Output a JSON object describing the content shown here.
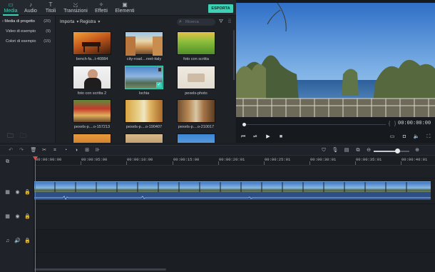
{
  "tabs": [
    {
      "label": "Media",
      "icon": "folder-icon",
      "active": true
    },
    {
      "label": "Audio",
      "icon": "music-note-icon"
    },
    {
      "label": "Titoli",
      "icon": "text-icon"
    },
    {
      "label": "Transizioni",
      "icon": "transition-icon"
    },
    {
      "label": "Effetti",
      "icon": "effects-icon"
    },
    {
      "label": "Elementi",
      "icon": "image-icon"
    }
  ],
  "export_label": "ESPORTA",
  "sidebar": {
    "items": [
      {
        "label": "Media di progetto",
        "count": "(20)",
        "expanded": true
      },
      {
        "label": "Video di esempio",
        "count": "(9)"
      },
      {
        "label": "Colori di esempio",
        "count": "(15)"
      }
    ]
  },
  "media_toolbar": {
    "import_label": "Importa",
    "record_label": "Registra",
    "search_placeholder": "Ricerca"
  },
  "media_items": [
    {
      "label": "bench-fa...t-40884",
      "thumb": "bench"
    },
    {
      "label": "city-road....reet-italy",
      "thumb": "city"
    },
    {
      "label": "foto con scritta",
      "thumb": "green"
    },
    {
      "label": "foto con scritta 2",
      "thumb": "girl"
    },
    {
      "label": "Ischia",
      "thumb": "ischia",
      "in_use": true
    },
    {
      "label": "pexels-photo",
      "thumb": "phone"
    },
    {
      "label": "pexels-p....o-157213",
      "thumb": "shop"
    },
    {
      "label": "pexels-p....o-190407",
      "thumb": "alley"
    },
    {
      "label": "pexels-p....o-210017",
      "thumb": "street"
    },
    {
      "label": "",
      "thumb": "orange"
    },
    {
      "label": "",
      "thumb": "sand"
    },
    {
      "label": "",
      "thumb": "sky"
    }
  ],
  "preview": {
    "timecode": "00:00:00:00",
    "progress": 0
  },
  "timeline": {
    "ruler": [
      "00:00:00:00",
      "00:00:05:00",
      "00:00:10:00",
      "00:00:15:00",
      "00:00:20:01",
      "00:00:25:01",
      "00:00:30:01",
      "00:00:35:01",
      "00:00:40:01"
    ],
    "zoom_level": 0.65
  },
  "colors": {
    "accent": "#3fd1b5",
    "playhead": "#d94a4a",
    "audio_clip": "#2d4f86"
  }
}
